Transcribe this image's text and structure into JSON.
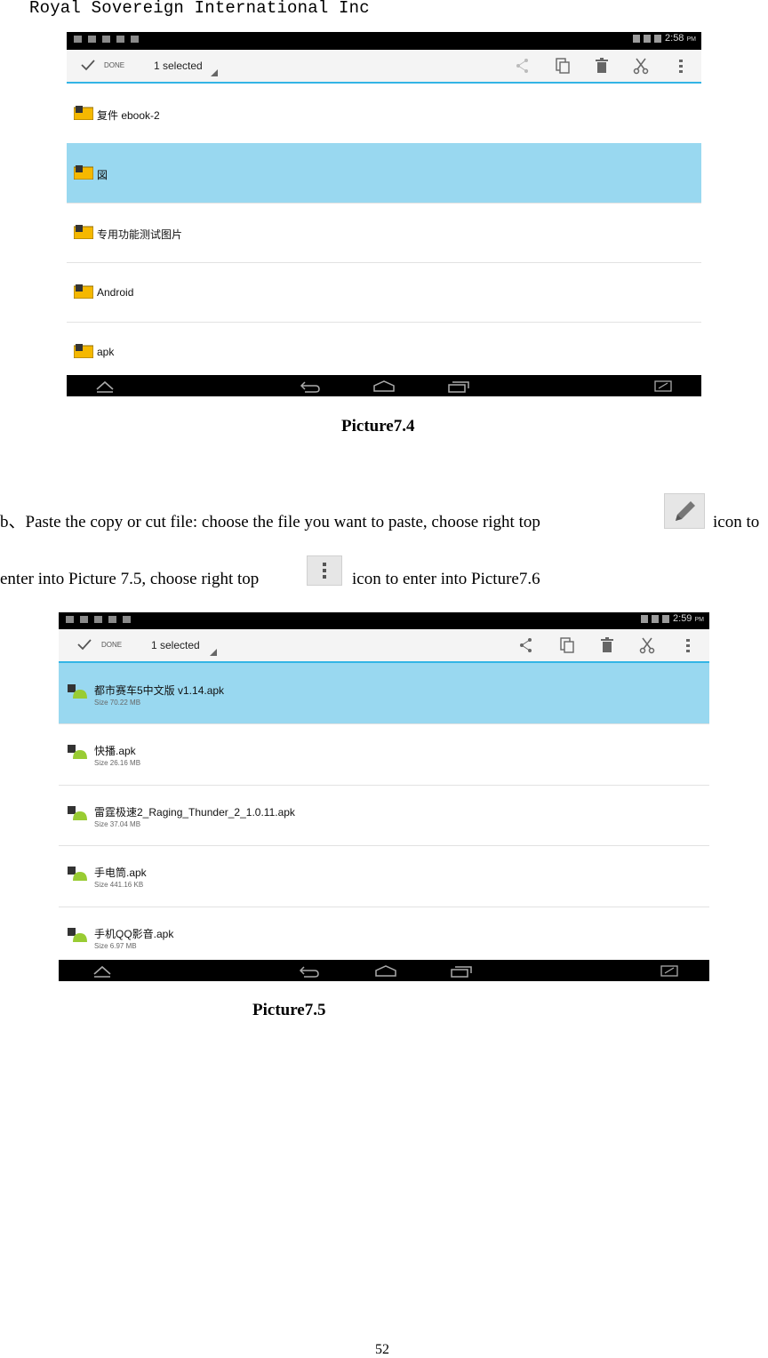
{
  "header": {
    "title": "Royal Sovereign International Inc"
  },
  "picture1": {
    "status_time": "2:58",
    "status_ampm": "PM",
    "actionbar": {
      "done_label": "DONE",
      "selected_label": "1 selected"
    },
    "rows": [
      {
        "name": "复件 ebook-2",
        "selected": false
      },
      {
        "name": "図",
        "selected": true
      },
      {
        "name": "专用功能测试图片",
        "selected": false
      },
      {
        "name": "Android",
        "selected": false
      },
      {
        "name": "apk",
        "selected": false
      }
    ],
    "caption": "Picture7.4"
  },
  "paragraph": {
    "line1_a": "b、Paste the copy or cut file: choose the file you want to paste, choose right top",
    "line1_b": "icon to",
    "line2_a": "enter into Picture 7.5, choose right top",
    "line2_b": "icon to enter into Picture7.6"
  },
  "picture2": {
    "status_time": "2:59",
    "status_ampm": "PM",
    "actionbar": {
      "done_label": "DONE",
      "selected_label": "1 selected"
    },
    "rows": [
      {
        "name": "都市赛车5中文版 v1.14.apk",
        "size": "Size 70.22 MB",
        "selected": true
      },
      {
        "name": "快播.apk",
        "size": "Size 26.16 MB",
        "selected": false
      },
      {
        "name": "雷霆极速2_Raging_Thunder_2_1.0.11.apk",
        "size": "Size 37.04 MB",
        "selected": false
      },
      {
        "name": "手电筒.apk",
        "size": "Size 441.16 KB",
        "selected": false
      },
      {
        "name": "手机QQ影音.apk",
        "size": "Size 6.97 MB",
        "selected": false
      }
    ],
    "caption": "Picture7.5"
  },
  "footer": {
    "page_number": "52"
  },
  "colors": {
    "selected_row": "#99d8f0",
    "accent": "#33b5e5",
    "folder": "#f5b800"
  },
  "icons": {
    "paste_icon": "pencil-icon",
    "menu_icon": "overflow-menu-icon"
  }
}
